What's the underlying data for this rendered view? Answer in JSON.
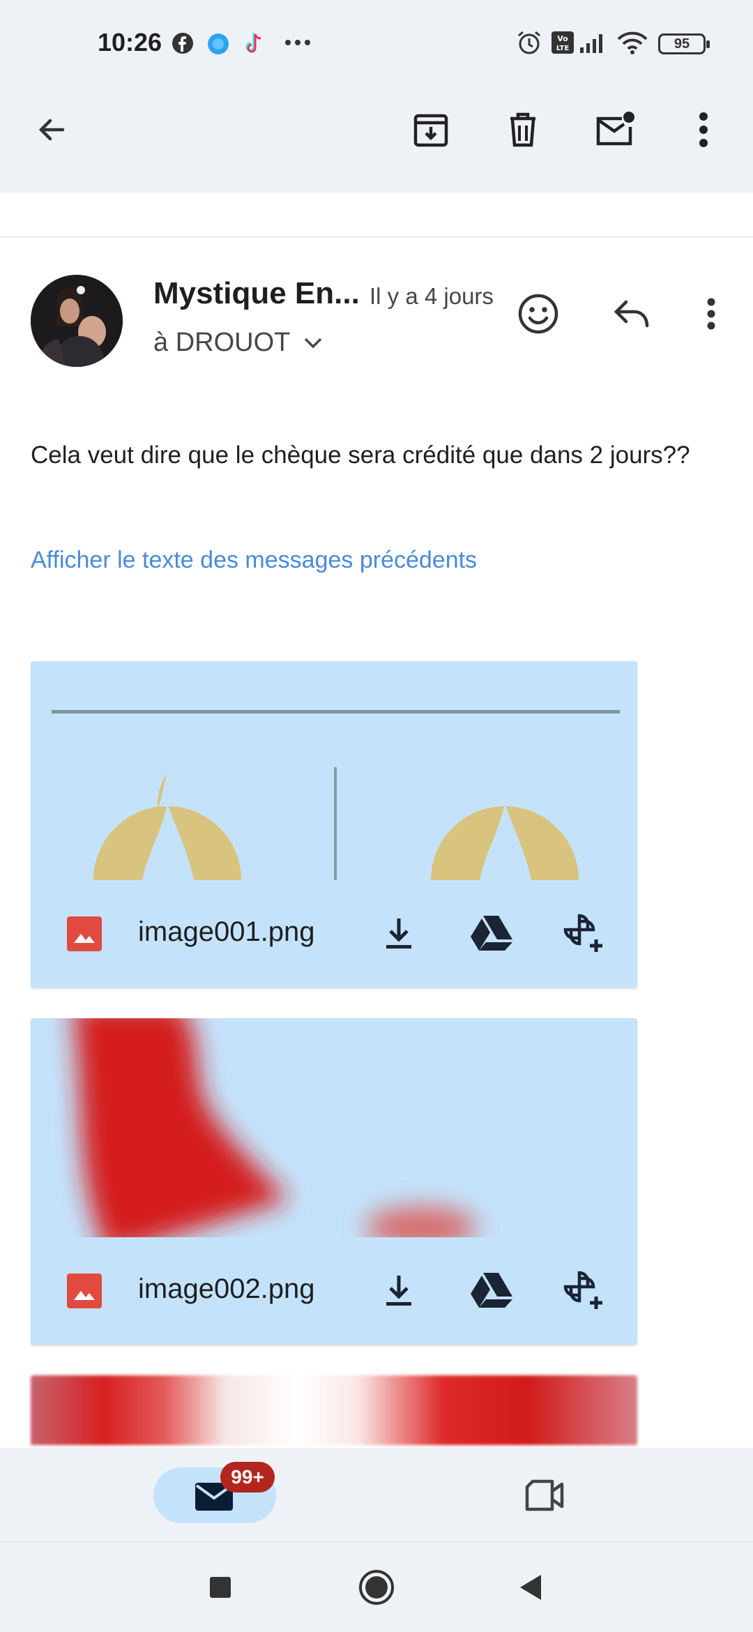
{
  "status_bar": {
    "time": "10:26",
    "battery_level": "95",
    "icons": [
      "facebook-icon",
      "browser-icon",
      "tiktok-icon",
      "more-notifications-icon",
      "alarm-icon",
      "volte-icon",
      "signal-icon",
      "wifi-icon",
      "battery-icon"
    ]
  },
  "toolbar": {
    "icons": [
      "back-arrow-icon",
      "archive-icon",
      "delete-icon",
      "mark-unread-icon",
      "more-vert-icon"
    ]
  },
  "message": {
    "sender_name": "Mystique En...",
    "time": "Il y a 4 jours",
    "recipient": "à DROUOT",
    "body": "Cela veut dire que le chèque sera crédité que dans 2 jours??",
    "show_previous": "Afficher le texte des messages précédents",
    "header_icons": [
      "emoji-reaction-icon",
      "reply-icon",
      "more-vert-icon"
    ]
  },
  "attachments": [
    {
      "name": "image001.png",
      "type_icon": "image-file-icon",
      "actions": [
        "download-icon",
        "drive-icon",
        "photos-add-icon"
      ]
    },
    {
      "name": "image002.png",
      "type_icon": "image-file-icon",
      "actions": [
        "download-icon",
        "drive-icon",
        "photos-add-icon"
      ]
    }
  ],
  "bottom_nav": {
    "mail_badge": "99+",
    "items": [
      "mail-icon",
      "video-icon"
    ]
  },
  "colors": {
    "chrome_bg": "#eef1f6",
    "attachment_bg": "#c4e3fb",
    "link": "#4a8ad8",
    "badge": "#b3261e",
    "accent_red": "#d41c1c"
  }
}
